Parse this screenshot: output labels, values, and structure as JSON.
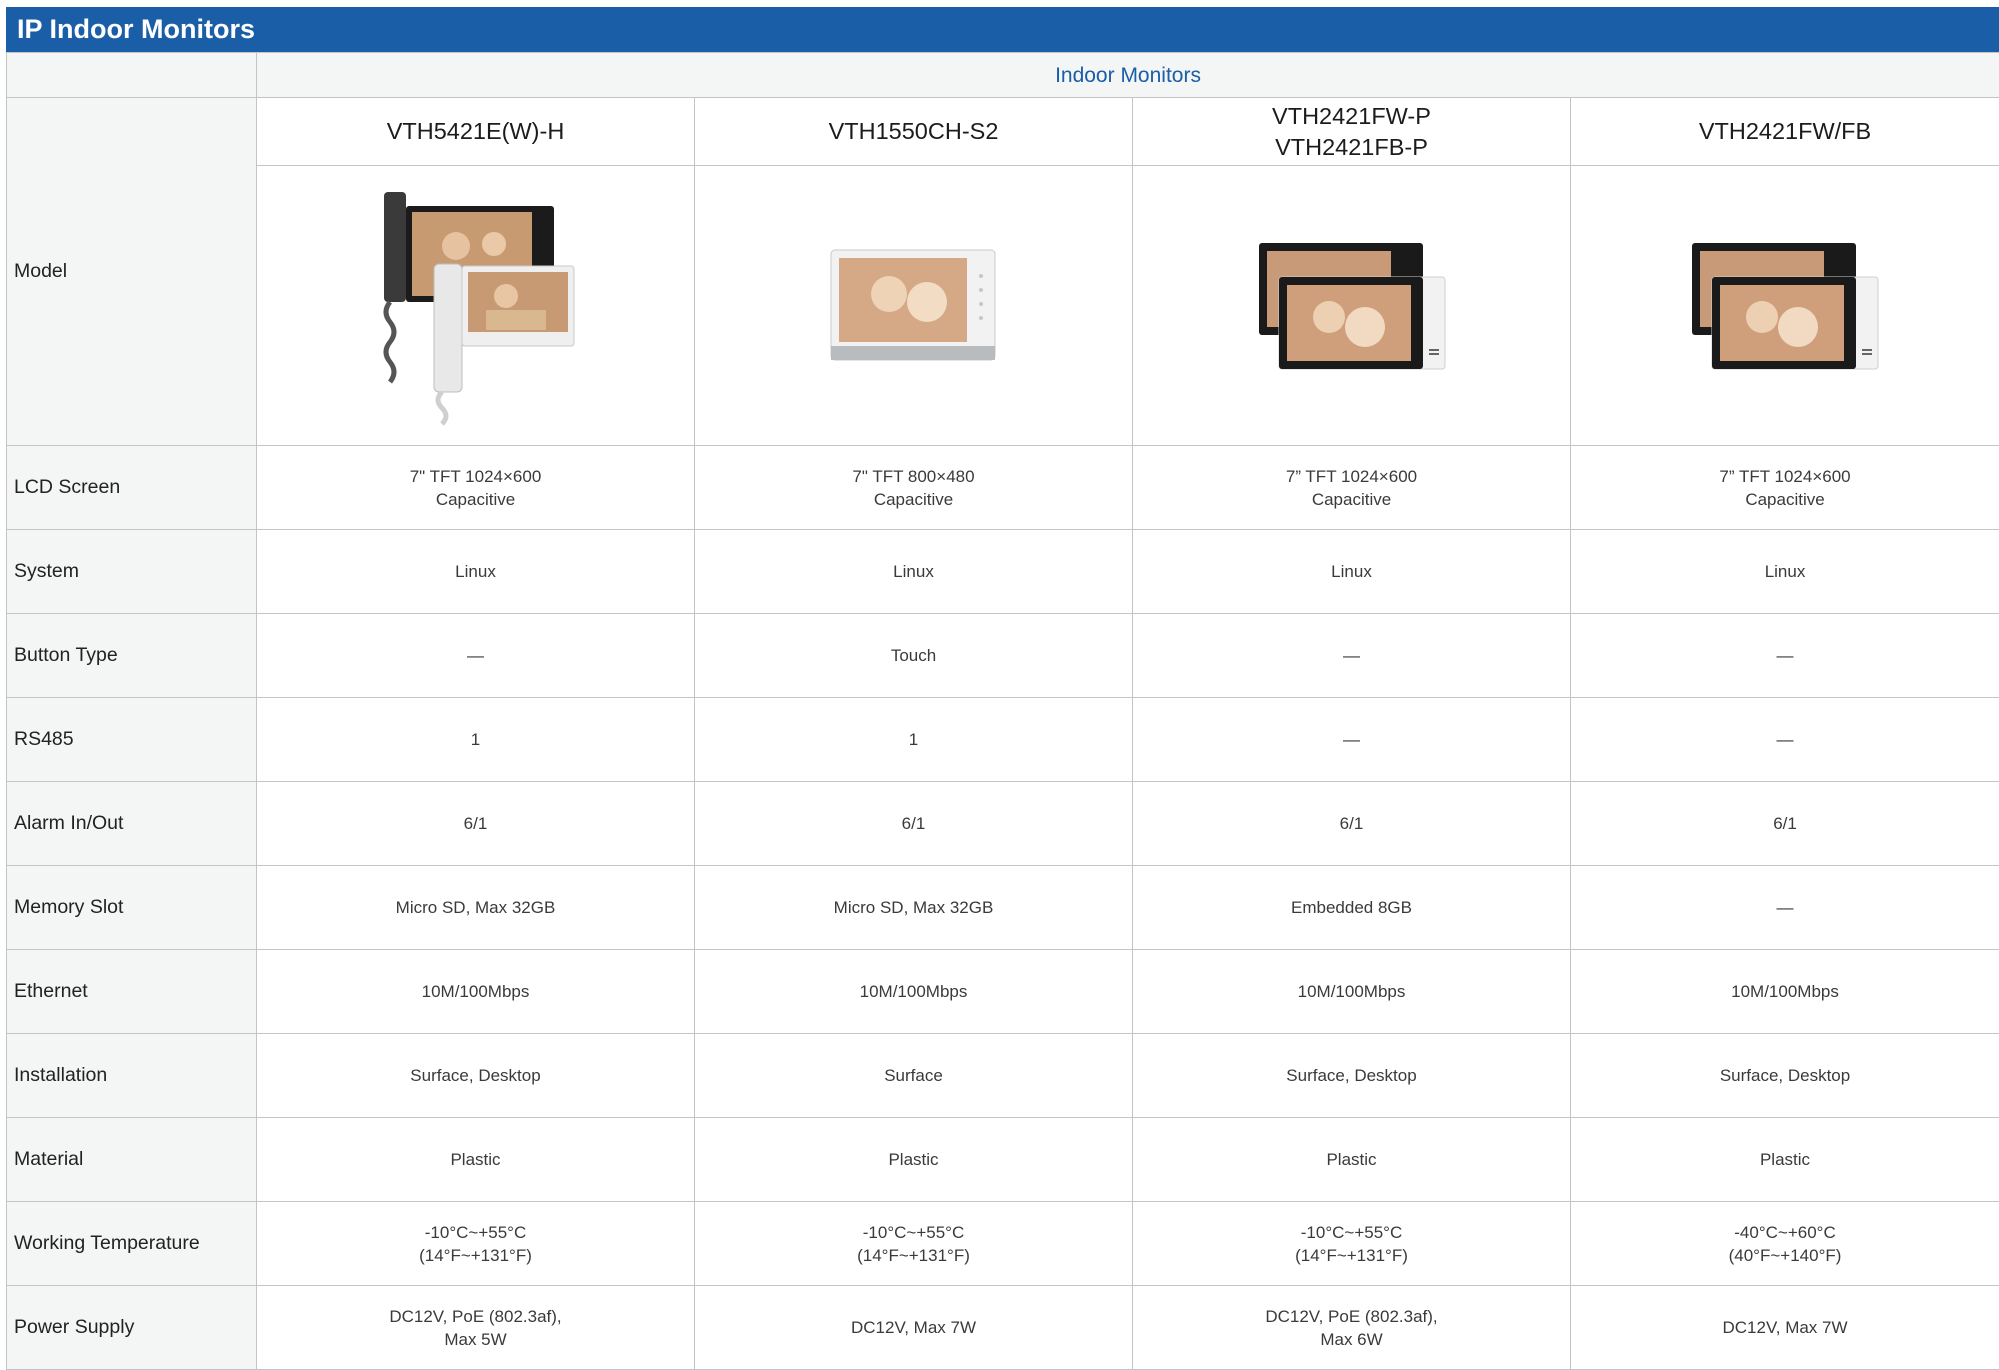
{
  "title": "IP Indoor Monitors",
  "group_header": "Indoor Monitors",
  "models": [
    {
      "name": "VTH5421E(W)-H",
      "image_icon": "indoor-monitor-with-handset-image"
    },
    {
      "name": "VTH1550CH-S2",
      "image_icon": "white-indoor-monitor-image"
    },
    {
      "name": "VTH2421FW-P\nVTH2421FB-P",
      "image_icon": "black-white-indoor-monitor-pair-image"
    },
    {
      "name": "VTH2421FW/FB",
      "image_icon": "black-white-indoor-monitor-pair-image"
    }
  ],
  "model_label": "Model",
  "rows": [
    {
      "label": "LCD Screen",
      "values": [
        "7\" TFT 1024×600\nCapacitive",
        "7\" TFT 800×480\nCapacitive",
        "7” TFT 1024×600\nCapacitive",
        "7” TFT 1024×600\nCapacitive"
      ]
    },
    {
      "label": "System",
      "values": [
        "Linux",
        "Linux",
        "Linux",
        "Linux"
      ]
    },
    {
      "label": "Button Type",
      "values": [
        "—",
        "Touch",
        "—",
        "—"
      ]
    },
    {
      "label": "RS485",
      "values": [
        "1",
        "1",
        "—",
        "—"
      ]
    },
    {
      "label": "Alarm In/Out",
      "values": [
        "6/1",
        "6/1",
        "6/1",
        "6/1"
      ]
    },
    {
      "label": "Memory Slot",
      "values": [
        "Micro SD, Max 32GB",
        "Micro SD, Max 32GB",
        "Embedded 8GB",
        "—"
      ]
    },
    {
      "label": "Ethernet",
      "values": [
        "10M/100Mbps",
        "10M/100Mbps",
        "10M/100Mbps",
        "10M/100Mbps"
      ]
    },
    {
      "label": "Installation",
      "values": [
        "Surface, Desktop",
        "Surface",
        "Surface, Desktop",
        "Surface, Desktop"
      ]
    },
    {
      "label": "Material",
      "values": [
        "Plastic",
        "Plastic",
        "Plastic",
        "Plastic"
      ]
    },
    {
      "label": "Working Temperature",
      "values": [
        "-10°C~+55°C\n(14°F~+131°F)",
        "-10°C~+55°C\n(14°F~+131°F)",
        "-10°C~+55°C\n(14°F~+131°F)",
        "-40°C~+60°C\n(40°F~+140°F)"
      ]
    },
    {
      "label": "Power Supply",
      "values": [
        "DC12V, PoE (802.3af),\nMax 5W",
        "DC12V, Max 7W",
        "DC12V, PoE (802.3af),\nMax 6W",
        "DC12V, Max 7W"
      ]
    }
  ],
  "colors": {
    "header_blue": "#1a5ea8",
    "border": "#c4c4c4",
    "label_bg": "#f4f5f5"
  }
}
